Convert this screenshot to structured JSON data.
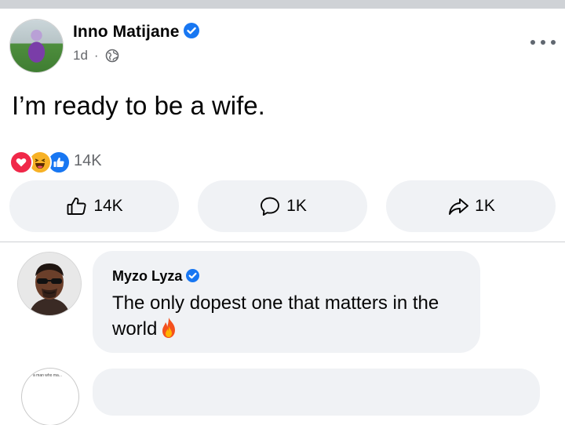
{
  "post": {
    "author": "Inno Matijane",
    "verified": true,
    "time": "1d",
    "separator": "·",
    "audience_icon": "globe-icon",
    "more_icon": "more-options-icon",
    "text": "I’m ready to be a wife."
  },
  "reactions": {
    "types": [
      "love",
      "haha",
      "like"
    ],
    "count": "14K"
  },
  "actions": {
    "like": {
      "label": "14K",
      "icon": "thumbs-up-icon"
    },
    "comment": {
      "label": "1K",
      "icon": "comment-icon"
    },
    "share": {
      "label": "1K",
      "icon": "share-icon"
    }
  },
  "comments": [
    {
      "author": "Myzo Lyza",
      "verified": true,
      "text": "The only dopest one that matters in the world",
      "emoji": "fire-emoji"
    }
  ],
  "next_comment": {
    "avatar_caption": "a man who ma..."
  },
  "colors": {
    "facebook_blue": "#1877f2",
    "bubble_gray": "#f0f2f5",
    "secondary_text": "#65676b",
    "love_red": "#f02849",
    "haha_yellow": "#f7b125"
  }
}
